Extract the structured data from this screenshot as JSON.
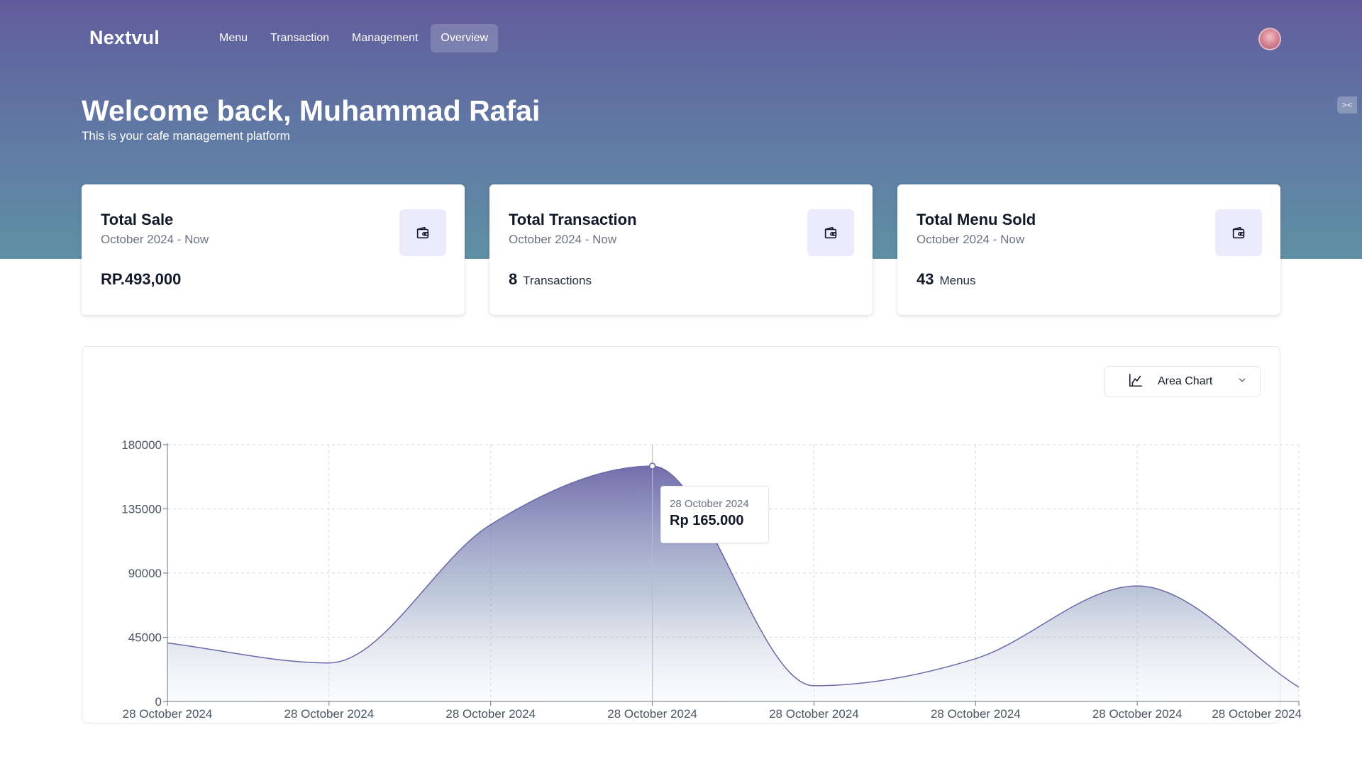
{
  "app": {
    "brand": "Nextvul"
  },
  "nav": {
    "items": [
      {
        "label": "Menu",
        "active": false
      },
      {
        "label": "Transaction",
        "active": false
      },
      {
        "label": "Management",
        "active": false
      },
      {
        "label": "Overview",
        "active": true
      }
    ]
  },
  "header": {
    "welcome": "Welcome back, Muhammad Rafai",
    "subtitle": "This is your cafe management platform"
  },
  "cards": [
    {
      "title": "Total Sale",
      "period": "October 2024 - Now",
      "value": "RP.493,000",
      "unit": "",
      "icon": "wallet-icon"
    },
    {
      "title": "Total Transaction",
      "period": "October 2024 - Now",
      "value": "8",
      "unit": "Transactions",
      "icon": "wallet-icon"
    },
    {
      "title": "Total Menu Sold",
      "period": "October 2024 - Now",
      "value": "43",
      "unit": "Menus",
      "icon": "wallet-icon"
    }
  ],
  "chart_controls": {
    "selected_type": "Area Chart",
    "icon": "area-chart-icon"
  },
  "tooltip": {
    "date": "28 October 2024",
    "value": "Rp 165.000"
  },
  "colors": {
    "accent": "#6b67a8",
    "hero_top": "#615c9c",
    "hero_bottom": "#5f90a4",
    "card_icon_bg": "#ecebfb"
  },
  "chart_data": {
    "type": "area",
    "x": [
      "28 October 2024",
      "28 October 2024",
      "28 October 2024",
      "28 October 2024",
      "28 October 2024",
      "28 October 2024",
      "28 October 2024",
      "28 October 2024"
    ],
    "series": [
      {
        "values": [
          41000,
          27000,
          124000,
          165000,
          11000,
          30000,
          81000,
          10000
        ]
      }
    ],
    "yticks": [
      "0",
      "45000",
      "90000",
      "135000",
      "180000"
    ],
    "ylim": [
      0,
      180000
    ],
    "grid": true,
    "highlighted_index": 3
  }
}
